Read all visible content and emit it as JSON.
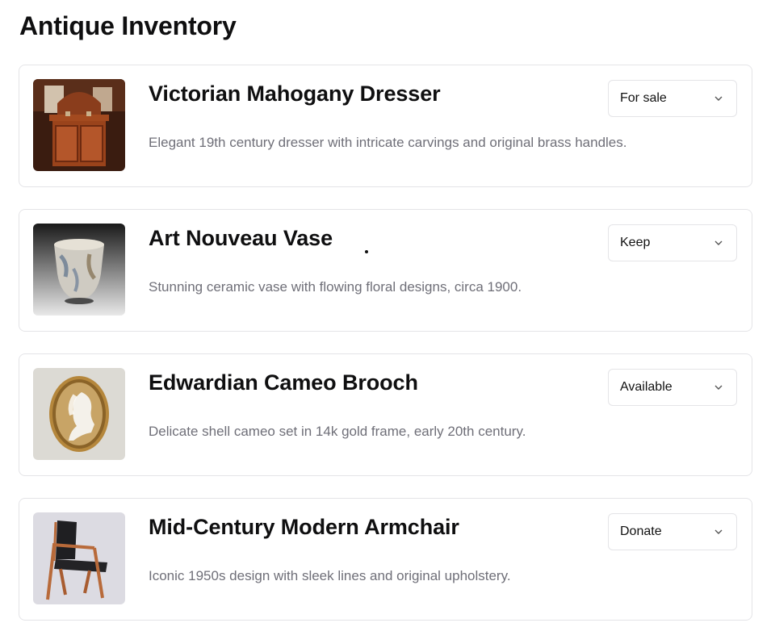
{
  "page": {
    "title": "Antique Inventory"
  },
  "status_options_visible": [
    "For sale",
    "Keep",
    "Available",
    "Donate"
  ],
  "items": [
    {
      "name": "Victorian Mahogany Dresser",
      "description": "Elegant 19th century dresser with intricate carvings and original brass handles.",
      "status": "For sale",
      "image": "mahogany-dresser-photo"
    },
    {
      "name": "Art Nouveau Vase",
      "description": "Stunning ceramic vase with flowing floral designs, circa 1900.",
      "status": "Keep",
      "image": "ceramic-vase-photo"
    },
    {
      "name": "Edwardian Cameo Brooch",
      "description": "Delicate shell cameo set in 14k gold frame, early 20th century.",
      "status": "Available",
      "image": "cameo-brooch-photo"
    },
    {
      "name": "Mid-Century Modern Armchair",
      "description": "Iconic 1950s design with sleek lines and original upholstery.",
      "status": "Donate",
      "image": "armchair-photo"
    }
  ],
  "colors": {
    "title": "#0f0f10",
    "description": "#6f6f78",
    "border": "#e4e4e7"
  },
  "icons": {
    "select_chevron": "chevron-down-icon"
  }
}
